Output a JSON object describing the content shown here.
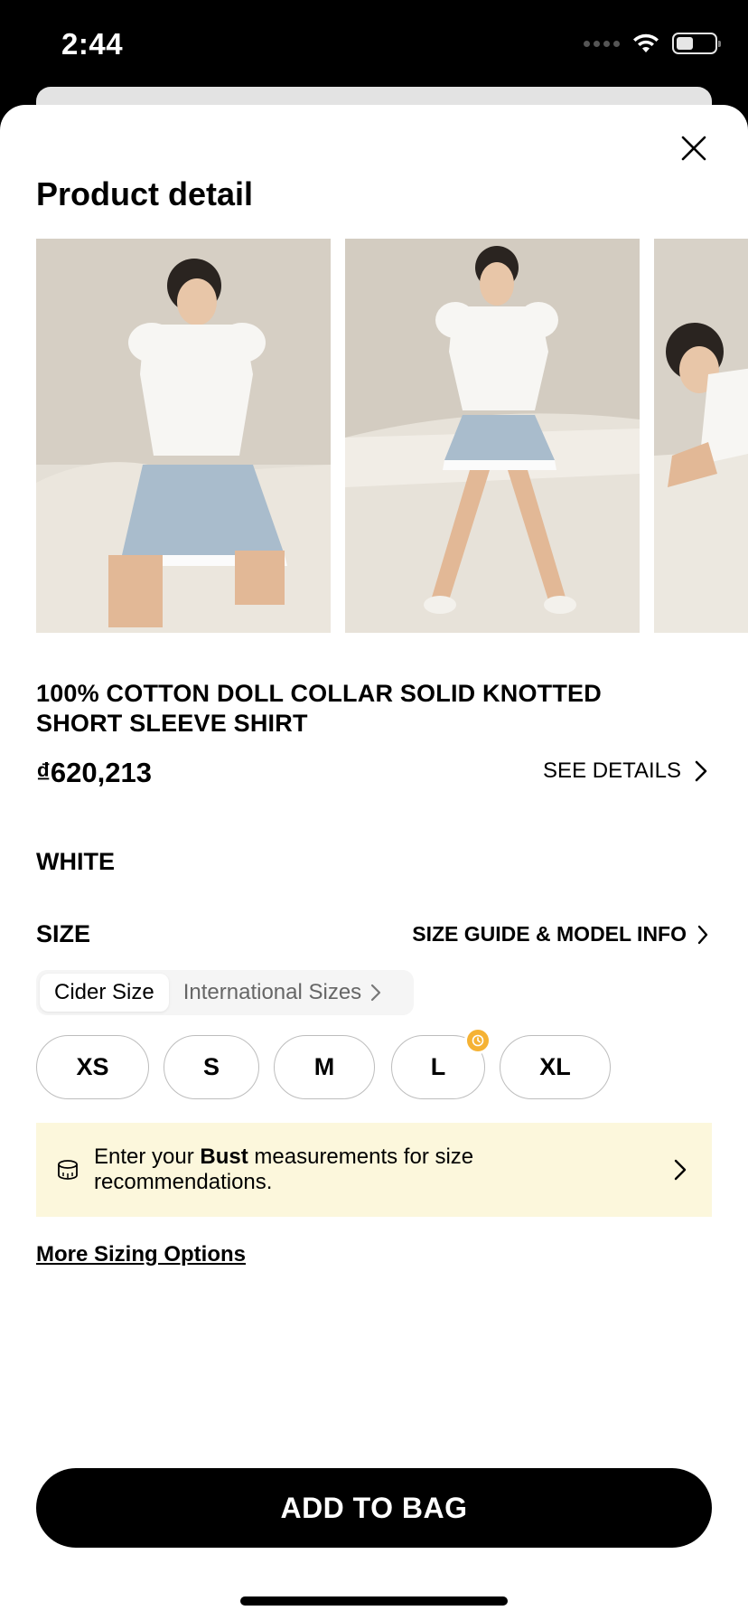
{
  "status": {
    "time": "2:44"
  },
  "sheet": {
    "title": "Product detail"
  },
  "product": {
    "name": "100% COTTON DOLL COLLAR SOLID KNOTTED SHORT SLEEVE SHIRT",
    "price": "₫620,213",
    "see_details": "SEE DETAILS",
    "color": "WHITE"
  },
  "size": {
    "label": "SIZE",
    "guide_link": "SIZE GUIDE & MODEL INFO",
    "systems": [
      "Cider Size",
      "International Sizes"
    ],
    "active_system": "Cider Size",
    "options": [
      {
        "label": "XS",
        "low_stock": false
      },
      {
        "label": "S",
        "low_stock": false
      },
      {
        "label": "M",
        "low_stock": false
      },
      {
        "label": "L",
        "low_stock": true
      },
      {
        "label": "XL",
        "low_stock": false
      }
    ]
  },
  "recommendation": {
    "prefix": "Enter your ",
    "bold": "Bust",
    "suffix": " measurements for size recommendations."
  },
  "more_sizing": "More Sizing Options",
  "cta": {
    "add_to_bag": "ADD TO BAG"
  },
  "colors": {
    "accent": "#000000",
    "reco_bg": "#fcf7dc",
    "badge": "#f5b234"
  }
}
